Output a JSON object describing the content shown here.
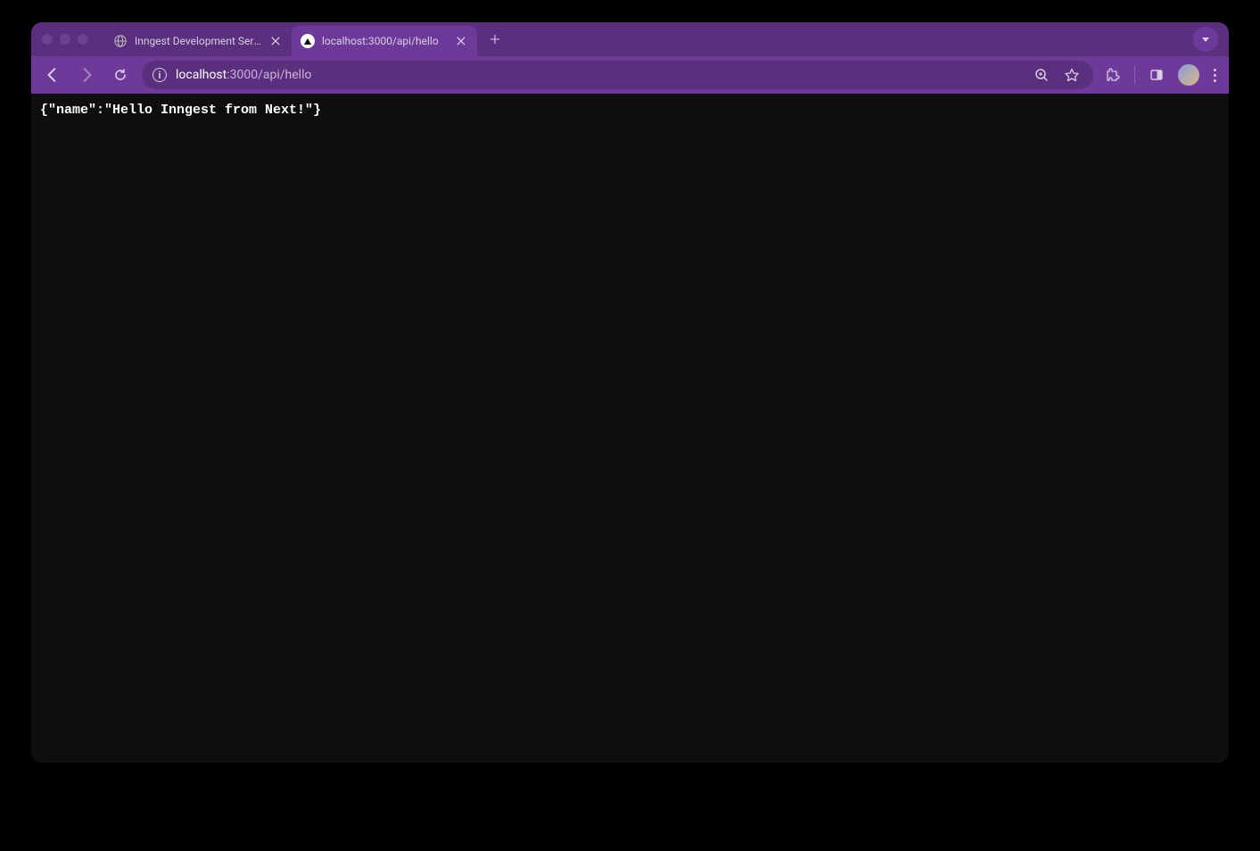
{
  "tabs": [
    {
      "title": "Inngest Development Server",
      "favicon": "globe",
      "active": false
    },
    {
      "title": "localhost:3000/api/hello",
      "favicon": "triangle",
      "active": true
    }
  ],
  "address_bar": {
    "host": "localhost",
    "path": ":3000/api/hello"
  },
  "page_content": "{\"name\":\"Hello Inngest from Next!\"}"
}
